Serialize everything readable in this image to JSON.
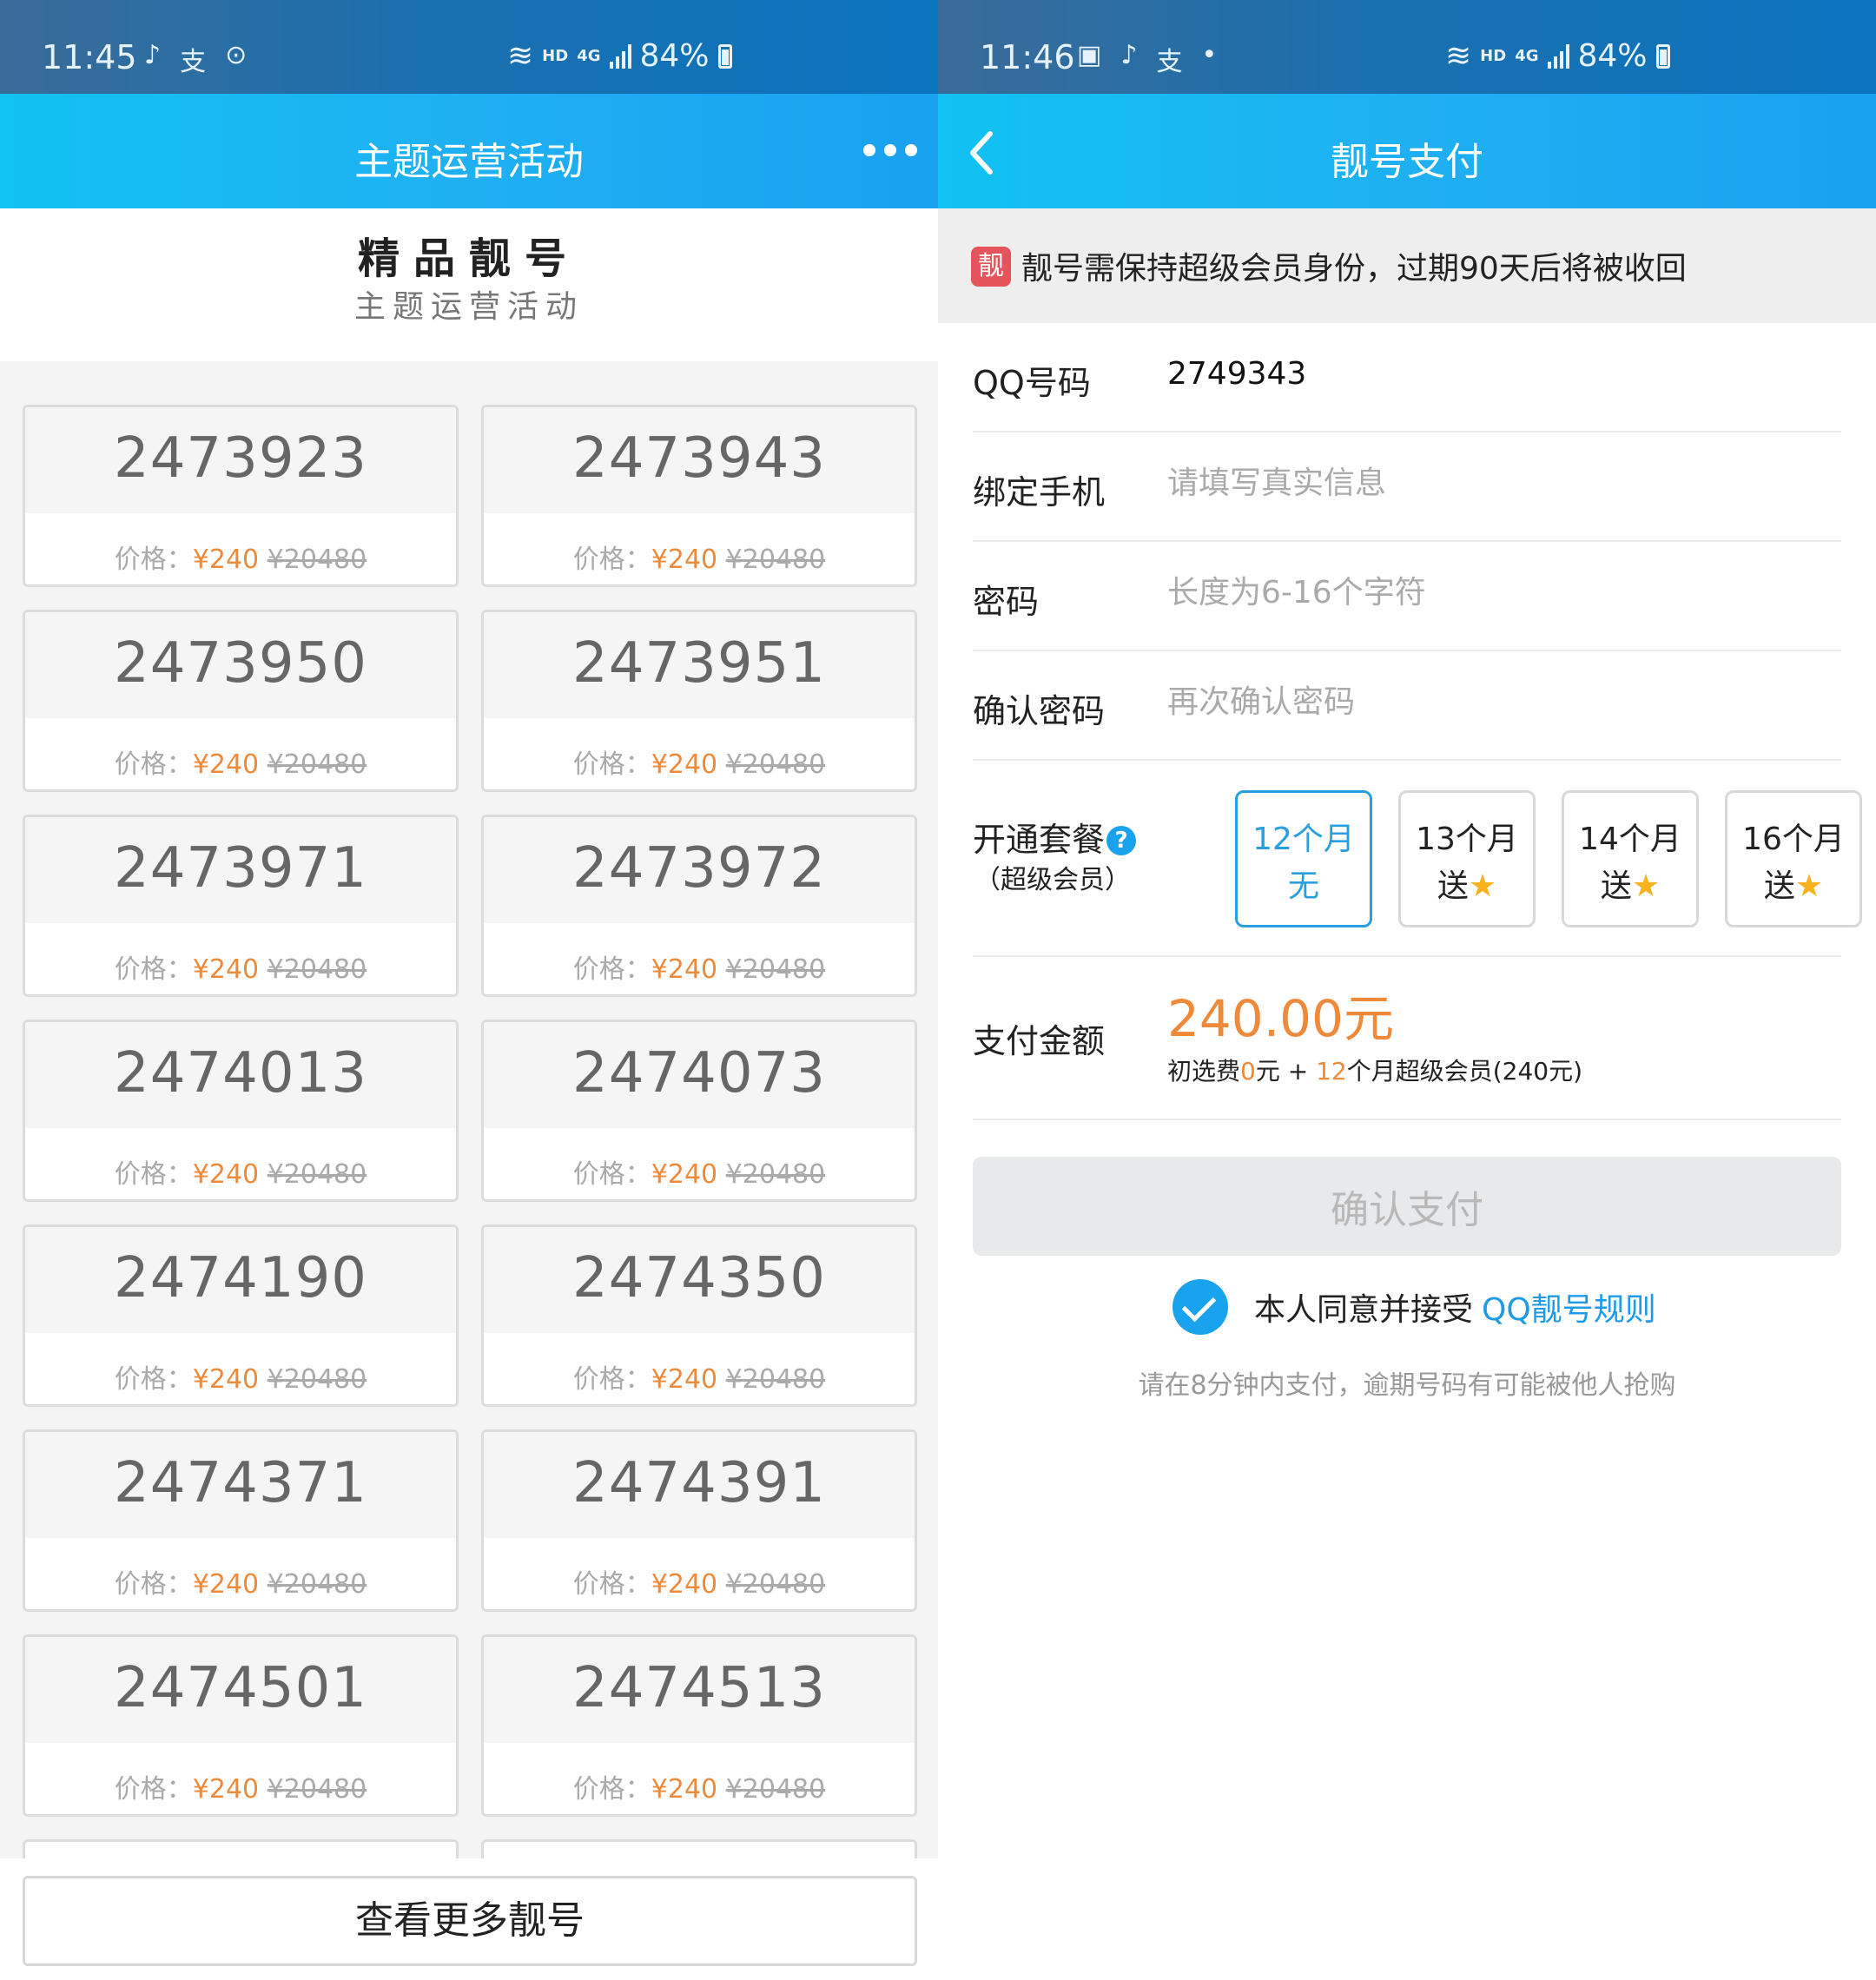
{
  "left": {
    "status": {
      "time": "11:45",
      "hd": "HD",
      "net": "4G",
      "battery": "84%"
    },
    "title": "主题运营活动",
    "heading": "精品靓号",
    "subheading": "主题运营活动",
    "price_label": "价格：",
    "price_now": "¥240",
    "price_old": "¥20480",
    "numbers": [
      "2473923",
      "2473943",
      "2473950",
      "2473951",
      "2473971",
      "2473972",
      "2474013",
      "2474073",
      "2474190",
      "2474350",
      "2474371",
      "2474391",
      "2474501",
      "2474513"
    ],
    "more_button": "查看更多靓号"
  },
  "right": {
    "status": {
      "time": "11:46",
      "dot": "•",
      "hd": "HD",
      "net": "4G",
      "battery": "84%"
    },
    "title": "靓号支付",
    "notice_badge": "靓",
    "notice": "靓号需保持超级会员身份，过期90天后将被收回",
    "qq_label": "QQ号码",
    "qq_value": "2749343",
    "phone_label": "绑定手机",
    "phone_placeholder": "请填写真实信息",
    "pwd_label": "密码",
    "pwd_placeholder": "长度为6-16个字符",
    "pwd2_label": "确认密码",
    "pwd2_placeholder": "再次确认密码",
    "plan_label": "开通套餐",
    "plan_help": "?",
    "plan_sub": "（超级会员）",
    "plans": [
      {
        "months": "12个月",
        "bonus": "无",
        "star": false
      },
      {
        "months": "13个月",
        "bonus": "送",
        "star": true
      },
      {
        "months": "14个月",
        "bonus": "送",
        "star": true
      },
      {
        "months": "16个月",
        "bonus": "送",
        "star": true
      }
    ],
    "star_glyph": "★",
    "pay_label": "支付金额",
    "pay_amount": "240.00元",
    "detail_a": "初选费",
    "detail_b": "0",
    "detail_c": "元 + ",
    "detail_d": "12",
    "detail_e": "个月超级会员(240元)",
    "confirm": "确认支付",
    "agree_text": "本人同意并接受",
    "agree_link": "QQ靓号规则",
    "tip": "请在8分钟内支付，逾期号码有可能被他人抢购"
  },
  "colors": {
    "accent": "#19a3ee",
    "price": "#ef8a3a",
    "badge": "#e5545a"
  }
}
